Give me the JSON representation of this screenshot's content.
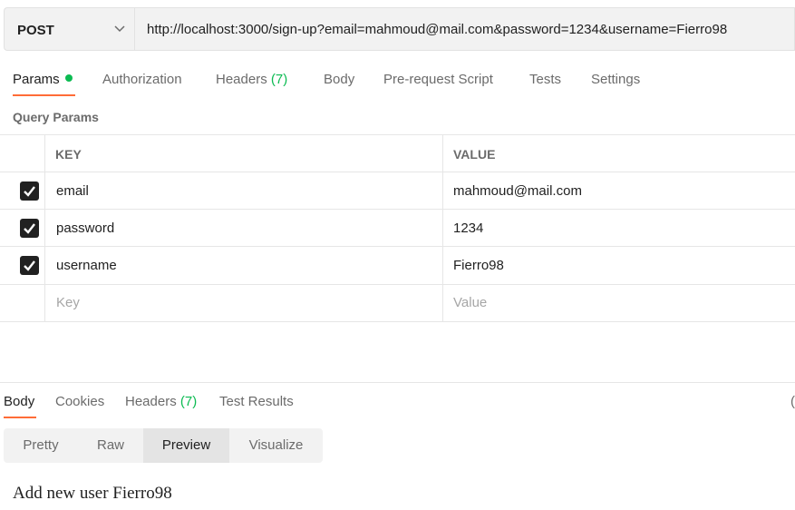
{
  "request": {
    "method": "POST",
    "url": "http://localhost:3000/sign-up?email=mahmoud@mail.com&password=1234&username=Fierro98"
  },
  "tabs": [
    {
      "label": "Params"
    },
    {
      "label": "Authorization"
    },
    {
      "label": "Headers",
      "count": "(7)"
    },
    {
      "label": "Body"
    },
    {
      "label": "Pre-request Script"
    },
    {
      "label": "Tests"
    },
    {
      "label": "Settings"
    }
  ],
  "query_params": {
    "title": "Query Params",
    "headers": {
      "key": "KEY",
      "value": "VALUE"
    },
    "rows": [
      {
        "key": "email",
        "value": "mahmoud@mail.com"
      },
      {
        "key": "password",
        "value": "1234"
      },
      {
        "key": "username",
        "value": "Fierro98"
      }
    ],
    "placeholder": {
      "key": "Key",
      "value": "Value"
    }
  },
  "response": {
    "tabs": [
      {
        "label": "Body"
      },
      {
        "label": "Cookies"
      },
      {
        "label": "Headers",
        "count": "(7)"
      },
      {
        "label": "Test Results"
      }
    ],
    "edge_glyph": "(",
    "formats": [
      "Pretty",
      "Raw",
      "Preview",
      "Visualize"
    ],
    "selected_format": "Preview",
    "preview_text": "Add new user Fierro98"
  },
  "colors": {
    "accent": "#ff6c37",
    "success": "#0cbb52",
    "checkbox": "#212121"
  }
}
